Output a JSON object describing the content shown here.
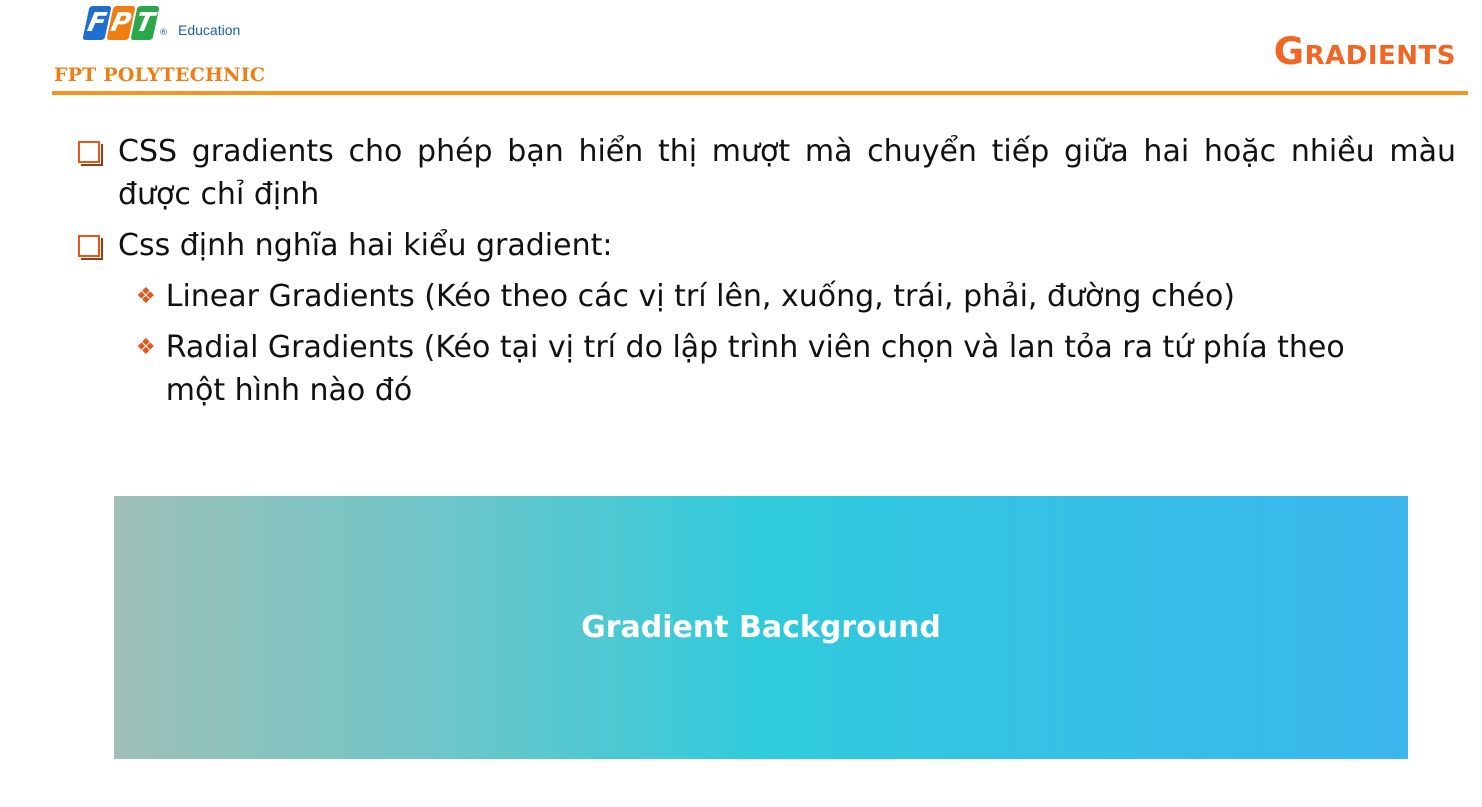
{
  "header": {
    "logo_letters": [
      "F",
      "P",
      "T"
    ],
    "logo_registered": "®",
    "logo_sub": "Education",
    "brand": "FPT POLYTECHNIC",
    "title": "Gradients",
    "colors": {
      "logo_f": "#1f6fd1",
      "logo_p": "#f07c12",
      "logo_t": "#2aa84a",
      "accent": "#f7941d",
      "title": "#f26522"
    }
  },
  "bullets": [
    {
      "text": "CSS gradients cho phép bạn hiển thị mượt mà chuyển tiếp giữa hai hoặc nhiều màu được chỉ định"
    },
    {
      "text": "Css định nghĩa hai kiểu gradient:"
    }
  ],
  "sub_bullets": [
    {
      "mark": "❖",
      "text": "Linear Gradients (Kéo theo các vị trí lên, xuống, trái, phải, đường chéo)"
    },
    {
      "mark": "❖",
      "text": "Radial Gradients (Kéo tại vị trí do lập trình viên chọn và lan tỏa ra tứ phía theo một hình nào đó"
    }
  ],
  "demo": {
    "label": "Gradient Background"
  }
}
